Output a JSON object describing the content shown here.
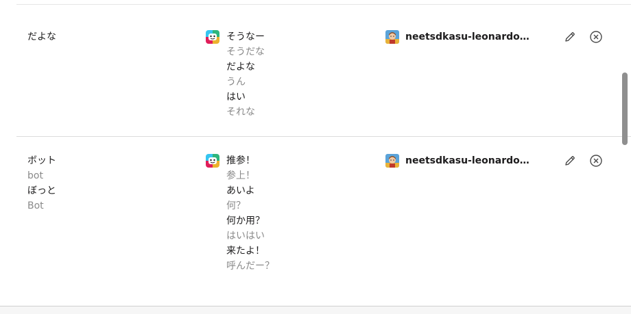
{
  "rules": [
    {
      "triggers": [
        {
          "text": "だよな",
          "muted": false
        }
      ],
      "responses": [
        {
          "text": "そうなー",
          "muted": false
        },
        {
          "text": "そうだな",
          "muted": true
        },
        {
          "text": "だよな",
          "muted": false
        },
        {
          "text": "うん",
          "muted": true
        },
        {
          "text": "はい",
          "muted": false
        },
        {
          "text": "それな",
          "muted": true
        }
      ],
      "author": "neetsdkasu-leonardo…"
    },
    {
      "triggers": [
        {
          "text": "ボット",
          "muted": false
        },
        {
          "text": "bot",
          "muted": true
        },
        {
          "text": "ぼっと",
          "muted": false
        },
        {
          "text": "Bot",
          "muted": true
        }
      ],
      "responses": [
        {
          "text": "推参！",
          "muted": false
        },
        {
          "text": "参上！",
          "muted": true
        },
        {
          "text": "あいよ",
          "muted": false
        },
        {
          "text": "何？",
          "muted": true
        },
        {
          "text": "何か用？",
          "muted": false
        },
        {
          "text": "はいはい",
          "muted": true
        },
        {
          "text": "来たよ！",
          "muted": false
        },
        {
          "text": "呼んだー？",
          "muted": true
        }
      ],
      "author": "neetsdkasu-leonardo…"
    }
  ],
  "icons": {
    "edit": "pencil-icon",
    "remove": "remove-circle-icon",
    "emoji": "slackbot-icon",
    "avatar": "user-avatar"
  },
  "colors": {
    "primary_text": "#1d1c1d",
    "muted_text": "#8a8a8a",
    "divider": "#dcdcdc"
  }
}
